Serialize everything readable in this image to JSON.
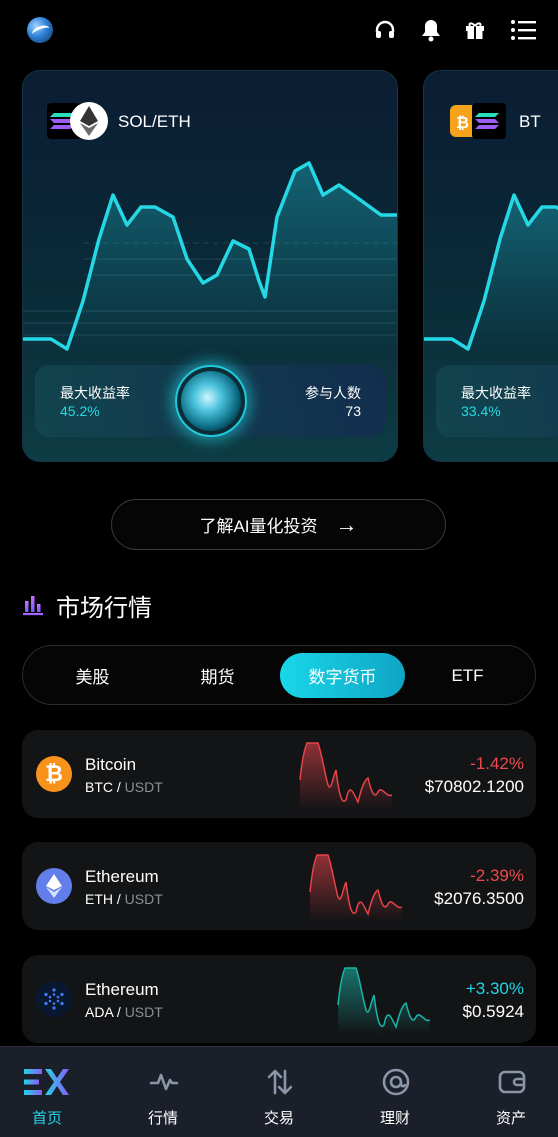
{
  "header": {
    "icons": [
      "app-logo",
      "headset-icon",
      "bell-icon",
      "gift-icon",
      "menu-icon"
    ]
  },
  "cards": [
    {
      "pair": "SOL/ETH",
      "max_yield_label": "最大收益率",
      "max_yield": "45.2%",
      "participants_label": "参与人数",
      "participants": "73"
    },
    {
      "pair": "BT",
      "max_yield_label": "最大收益率",
      "max_yield": "33.4%"
    }
  ],
  "learn_button": {
    "label": "了解AI量化投资",
    "arrow": "→"
  },
  "market": {
    "title": "市场行情",
    "tabs": [
      "美股",
      "期货",
      "数字货币",
      "ETF"
    ],
    "active_tab": "数字货币",
    "rows": [
      {
        "name": "Bitcoin",
        "base": "BTC",
        "sep": " / ",
        "quote": "USDT",
        "change": "-1.42%",
        "price": "$70802.1200",
        "trend": "down",
        "icon": "bitcoin-icon"
      },
      {
        "name": "Ethereum",
        "base": "ETH",
        "sep": " / ",
        "quote": "USDT",
        "change": "-2.39%",
        "price": "$2076.3500",
        "trend": "down",
        "icon": "ethereum-icon"
      },
      {
        "name": "Ethereum",
        "base": "ADA",
        "sep": " / ",
        "quote": "USDT",
        "change": "+3.30%",
        "price": "$0.5924",
        "trend": "up",
        "icon": "cardano-icon"
      }
    ]
  },
  "nav": {
    "items": [
      {
        "label": "首页",
        "icon": "ex-logo-icon",
        "active": true
      },
      {
        "label": "行情",
        "icon": "pulse-icon",
        "active": false
      },
      {
        "label": "交易",
        "icon": "swap-arrows-icon",
        "active": false
      },
      {
        "label": "理财",
        "icon": "finance-at-icon",
        "active": false
      },
      {
        "label": "资产",
        "icon": "wallet-icon",
        "active": false
      }
    ]
  },
  "colors": {
    "accent": "#22d3e6",
    "down": "#f0484b",
    "up": "#22d3e6",
    "card_line": "#25d8e6"
  }
}
